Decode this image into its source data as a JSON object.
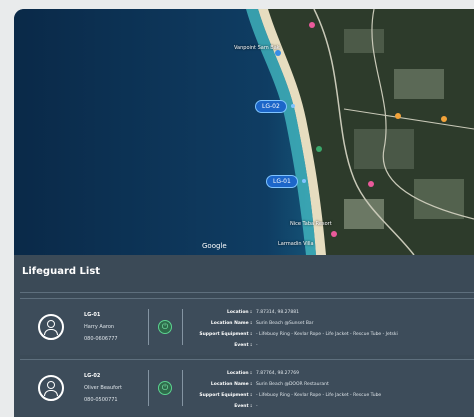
{
  "map": {
    "google_label": "Google",
    "places": [
      "Vanpoint Sam Bak",
      "Nice Taba Resort",
      "Larmadin Villa"
    ],
    "markers": [
      {
        "id": "LG-02",
        "label": "LG-02"
      },
      {
        "id": "LG-01",
        "label": "LG-01"
      }
    ],
    "colors": {
      "sea_deep": "#0b2d4e",
      "sea_shallow": "#2f9fb5",
      "beach": "#e9e2c7",
      "land": "#2c3a2a",
      "marker": "#1c66c9"
    }
  },
  "list": {
    "title": "Lifeguard List",
    "field_labels": {
      "location": "Location :",
      "location_name": "Location Name :",
      "support_equipment": "Support Equipment :",
      "event": "Event :"
    },
    "items": [
      {
        "id": "LG-01",
        "name": "Harry Aaron",
        "phone": "080-0606777",
        "status_icon": "power-icon",
        "location": "7.87314, 98.27881",
        "location_name": "Surin Beach @Sunset Bar",
        "support_equipment": "- Lifebuoy Ring   - Kevlar Rope   - Life Jacket   - Rescue Tube   - Jetski",
        "event": "-"
      },
      {
        "id": "LG-02",
        "name": "Oliver Beaufort",
        "phone": "080-0500771",
        "status_icon": "power-icon",
        "location": "7.87764, 98.27769",
        "location_name": "Surin Beach @DOOR Restaurant",
        "support_equipment": "- Lifebuoy Ring   - Kevlar Rope   - Life Jacket   - Rescue Tube",
        "event": "-"
      }
    ]
  }
}
